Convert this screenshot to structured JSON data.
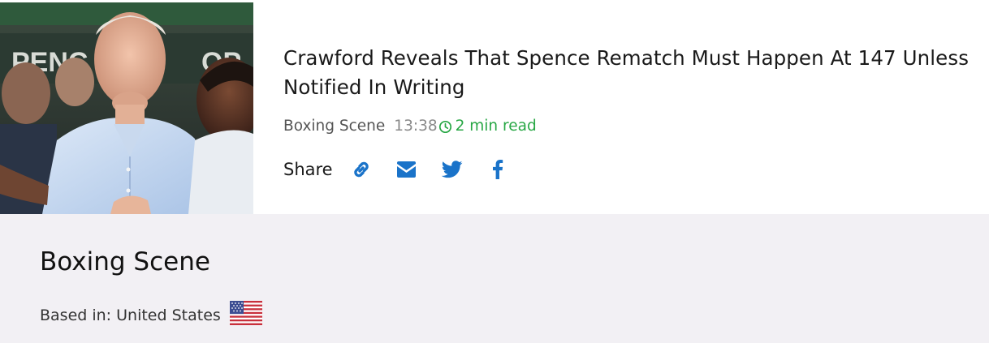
{
  "article": {
    "title": "Crawford Reveals That Spence Rematch Must Happen At 147 Unless Notified In Writing",
    "source": "Boxing Scene",
    "time": "13:38",
    "read_time": "2 min read",
    "thumbnail_banner_text": "PENC",
    "thumbnail_banner_text_right": "OP",
    "thumbnail_alt": "Man in light blue shirt at press conference next to boxer",
    "icons": {
      "clock": "clock-icon",
      "link": "link-icon",
      "email": "envelope-icon",
      "twitter": "twitter-icon",
      "facebook": "facebook-icon"
    }
  },
  "share": {
    "label": "Share"
  },
  "source_panel": {
    "name": "Boxing Scene",
    "based_in": "Based in: United States",
    "flag": "us-flag-icon"
  },
  "colors": {
    "accent_blue": "#1a73c9",
    "read_time_green": "#28a745",
    "panel_bg": "#f2f0f4"
  }
}
